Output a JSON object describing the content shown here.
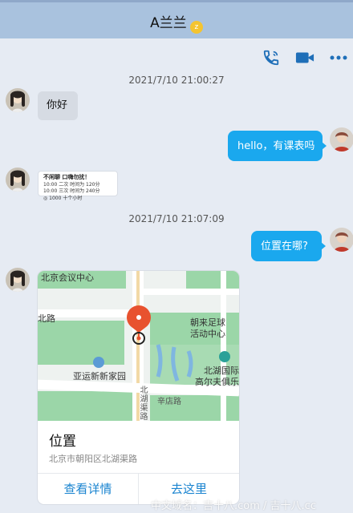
{
  "header": {
    "title": "A兰兰"
  },
  "toolbar": {
    "icons": [
      "phone-icon",
      "video-icon",
      "more-icon"
    ]
  },
  "messages": {
    "ts1": "2021/7/10 21:00:27",
    "m1": "你好",
    "m2": "hello，有课表吗",
    "card": {
      "head": "不闲聊 口嗨勿扰！",
      "line1": "10:00  二次 时间为 120分",
      "line2": "10:00  三次 时间为 240分",
      "line3": "◎ 1000    十个小时"
    },
    "ts2": "2021/7/10 21:07:09",
    "m3": "位置在哪?"
  },
  "location": {
    "title": "位置",
    "address": "北京市朝阳区北湖渠路",
    "view_details": "查看详情",
    "go_here": "去这里",
    "map_labels": {
      "a": "北京会议中心",
      "b": "北路",
      "c": "朝来足球",
      "d": "活动中心",
      "e": "亚运新新家园",
      "f": "北湖国际",
      "g": "高尔夫俱乐",
      "h": "北湖渠路",
      "i": "辛店路"
    },
    "colors": {
      "green": "#9bd6a8",
      "road": "#ffffff",
      "pin": "#e8522f"
    }
  },
  "watermark": "中文域名：吉十八.com / 吉十八.cc"
}
